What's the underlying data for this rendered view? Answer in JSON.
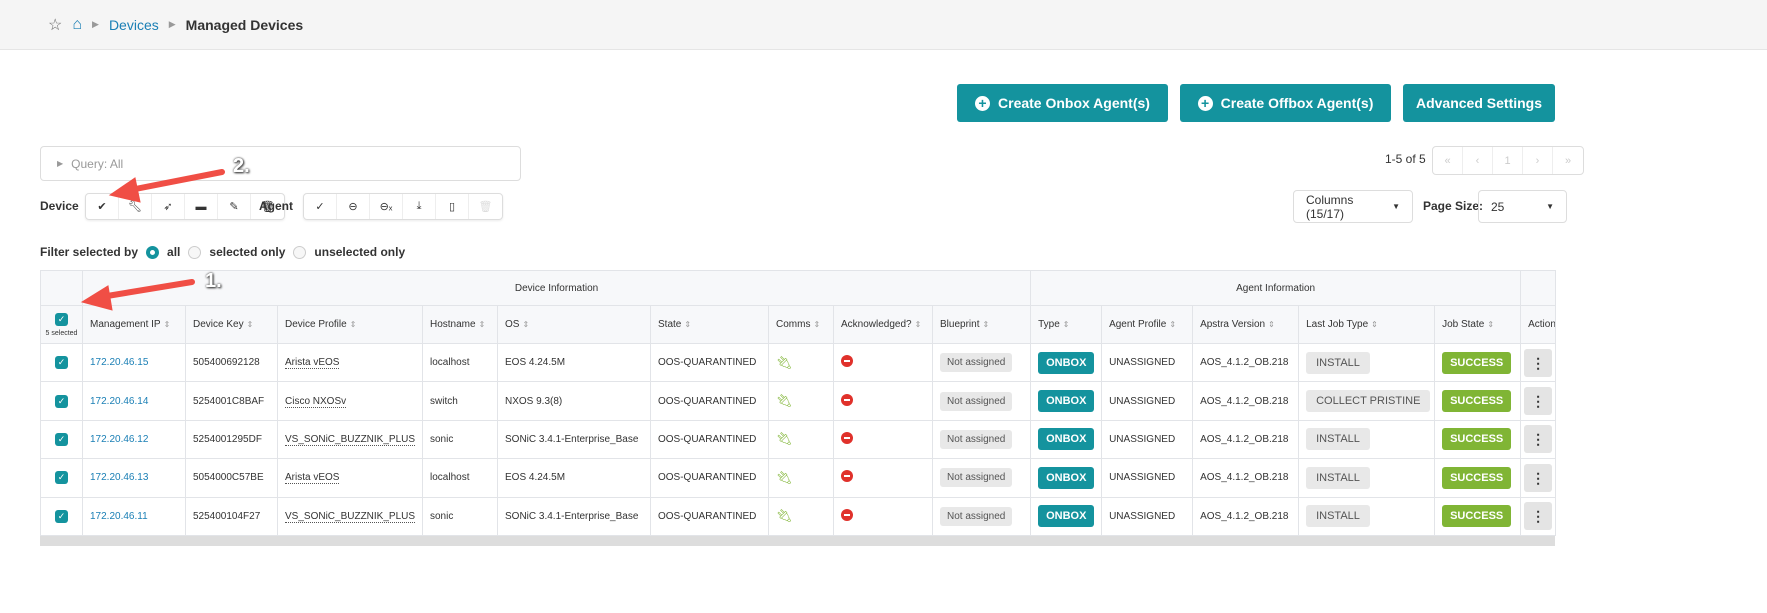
{
  "breadcrumb": {
    "items": [
      "Devices",
      "Managed Devices"
    ]
  },
  "actions": {
    "onbox": "Create Onbox Agent(s)",
    "offbox": "Create Offbox Agent(s)",
    "advanced": "Advanced Settings"
  },
  "query": {
    "label": "Query: All"
  },
  "pagination": {
    "summary": "1-5 of 5",
    "page": "1"
  },
  "toolbar": {
    "device_label": "Device",
    "agent_label": "Agent",
    "device_icons": [
      "acknowledge-icon",
      "wrench-icon",
      "rocket-icon",
      "archive-icon",
      "edit-icon",
      "trash-icon"
    ],
    "agent_icons": [
      "check-icon",
      "drive-icon",
      "drive-remove-icon",
      "download-icon",
      "file-icon",
      "trash-icon"
    ]
  },
  "columns_select": {
    "label": "Columns (15/17)"
  },
  "page_size": {
    "label": "Page Size:",
    "value": "25"
  },
  "filter": {
    "label": "Filter selected by",
    "options": [
      "all",
      "selected only",
      "unselected only"
    ],
    "selected": "all"
  },
  "annotations": [
    "1.",
    "2."
  ],
  "table": {
    "groups": {
      "device": "Device Information",
      "agent": "Agent Information"
    },
    "selected_count": "5 selected",
    "headers": [
      "Management IP",
      "Device Key",
      "Device Profile",
      "Hostname",
      "OS",
      "State",
      "Comms",
      "Acknowledged?",
      "Blueprint",
      "Type",
      "Agent Profile",
      "Apstra Version",
      "Last Job Type",
      "Job State",
      "Actions"
    ],
    "rows": [
      {
        "ip": "172.20.46.15",
        "key": "505400692128",
        "profile": "Arista vEOS",
        "hostname": "localhost",
        "os": "EOS 4.24.5M",
        "state": "OOS-QUARANTINED",
        "blueprint": "Not assigned",
        "type": "ONBOX",
        "agent_profile": "UNASSIGNED",
        "version": "AOS_4.1.2_OB.218",
        "last_job": "INSTALL",
        "job_state": "SUCCESS"
      },
      {
        "ip": "172.20.46.14",
        "key": "5254001C8BAF",
        "profile": "Cisco NXOSv",
        "hostname": "switch",
        "os": "NXOS 9.3(8)",
        "state": "OOS-QUARANTINED",
        "blueprint": "Not assigned",
        "type": "ONBOX",
        "agent_profile": "UNASSIGNED",
        "version": "AOS_4.1.2_OB.218",
        "last_job": "COLLECT PRISTINE",
        "job_state": "SUCCESS"
      },
      {
        "ip": "172.20.46.12",
        "key": "5254001295DF",
        "profile": "VS_SONiC_BUZZNIK_PLUS",
        "hostname": "sonic",
        "os": "SONiC 3.4.1-Enterprise_Base",
        "state": "OOS-QUARANTINED",
        "blueprint": "Not assigned",
        "type": "ONBOX",
        "agent_profile": "UNASSIGNED",
        "version": "AOS_4.1.2_OB.218",
        "last_job": "INSTALL",
        "job_state": "SUCCESS"
      },
      {
        "ip": "172.20.46.13",
        "key": "5054000C57BE",
        "profile": "Arista vEOS",
        "hostname": "localhost",
        "os": "EOS 4.24.5M",
        "state": "OOS-QUARANTINED",
        "blueprint": "Not assigned",
        "type": "ONBOX",
        "agent_profile": "UNASSIGNED",
        "version": "AOS_4.1.2_OB.218",
        "last_job": "INSTALL",
        "job_state": "SUCCESS"
      },
      {
        "ip": "172.20.46.11",
        "key": "525400104F27",
        "profile": "VS_SONiC_BUZZNIK_PLUS",
        "hostname": "sonic",
        "os": "SONiC 3.4.1-Enterprise_Base",
        "state": "OOS-QUARANTINED",
        "blueprint": "Not assigned",
        "type": "ONBOX",
        "agent_profile": "UNASSIGNED",
        "version": "AOS_4.1.2_OB.218",
        "last_job": "INSTALL",
        "job_state": "SUCCESS"
      }
    ]
  },
  "colors": {
    "accent": "#14939e",
    "success": "#80b535",
    "link": "#1a7fb5",
    "danger": "#e0312b",
    "annotation": "#f04e45"
  }
}
